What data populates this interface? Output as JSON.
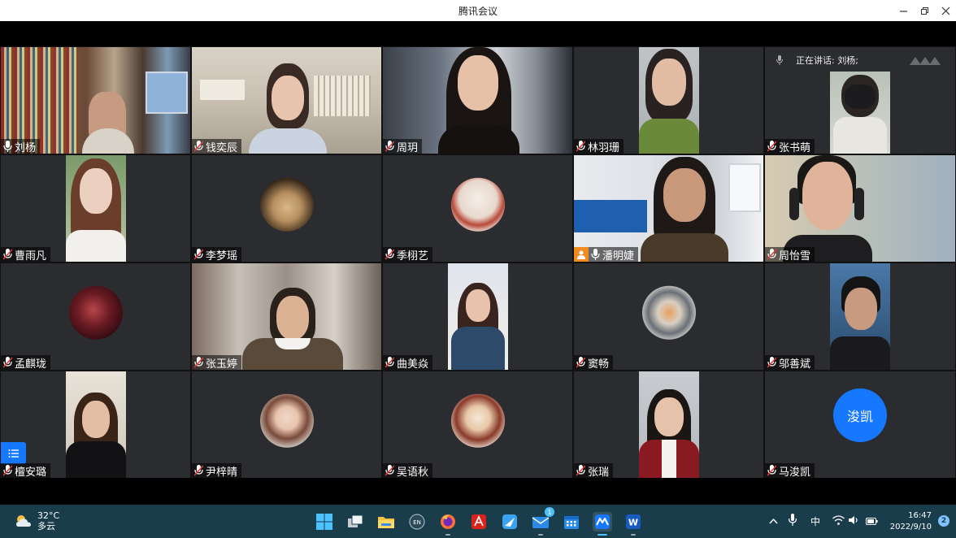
{
  "window": {
    "title": "腾讯会议",
    "controls": [
      "minimize-icon",
      "restore-icon",
      "close-icon"
    ]
  },
  "meeting": {
    "speaking_label": "正在讲话: 刘杨;",
    "participants": [
      {
        "name": "刘杨",
        "media": "video",
        "active_speaker": true,
        "mic": "on"
      },
      {
        "name": "钱奕辰",
        "media": "video",
        "mic": "muted"
      },
      {
        "name": "周玥",
        "media": "video",
        "mic": "muted"
      },
      {
        "name": "林羽珊",
        "media": "video",
        "mic": "muted"
      },
      {
        "name": "张书萌",
        "media": "video",
        "mic": "muted"
      },
      {
        "name": "曹雨凡",
        "media": "video",
        "mic": "muted"
      },
      {
        "name": "李梦瑶",
        "media": "avatar",
        "mic": "muted"
      },
      {
        "name": "季栩艺",
        "media": "avatar",
        "mic": "muted"
      },
      {
        "name": "潘明婕",
        "media": "video",
        "mic": "on",
        "host": true
      },
      {
        "name": "周怡雪",
        "media": "video",
        "mic": "muted"
      },
      {
        "name": "孟麒珑",
        "media": "avatar",
        "mic": "muted"
      },
      {
        "name": "张玉婷",
        "media": "video",
        "mic": "muted"
      },
      {
        "name": "曲美焱",
        "media": "video",
        "mic": "muted"
      },
      {
        "name": "窦畅",
        "media": "avatar",
        "mic": "muted"
      },
      {
        "name": "邬善斌",
        "media": "video",
        "mic": "muted"
      },
      {
        "name": "檀安璐",
        "media": "video",
        "mic": "muted"
      },
      {
        "name": "尹梓晴",
        "media": "avatar",
        "mic": "muted"
      },
      {
        "name": "吴语秋",
        "media": "avatar",
        "mic": "muted"
      },
      {
        "name": "张瑞",
        "media": "video",
        "mic": "muted"
      },
      {
        "name": "马浚凯",
        "media": "text-avatar",
        "avatar_text": "浚凯",
        "mic": "muted"
      }
    ]
  },
  "taskbar": {
    "weather": {
      "temp": "32°C",
      "desc": "多云"
    },
    "apps": [
      "windows-start-icon",
      "task-view-icon",
      "file-explorer-icon",
      "language-en-icon",
      "firefox-icon",
      "pdf-reader-icon",
      "feishu-icon",
      "mail-icon",
      "calendar-icon",
      "tencent-meeting-icon",
      "word-icon"
    ],
    "mail_badge": "1",
    "ime": "中",
    "time": "16:47",
    "date": "2022/9/10",
    "notifications": "2"
  },
  "colors": {
    "accent": "#1677ff",
    "active_speaker_border": "#27ae60",
    "host_badge": "#f08c1e",
    "tile_bg": "#2b2c2f",
    "taskbar_bg": "#1a3d4c"
  }
}
